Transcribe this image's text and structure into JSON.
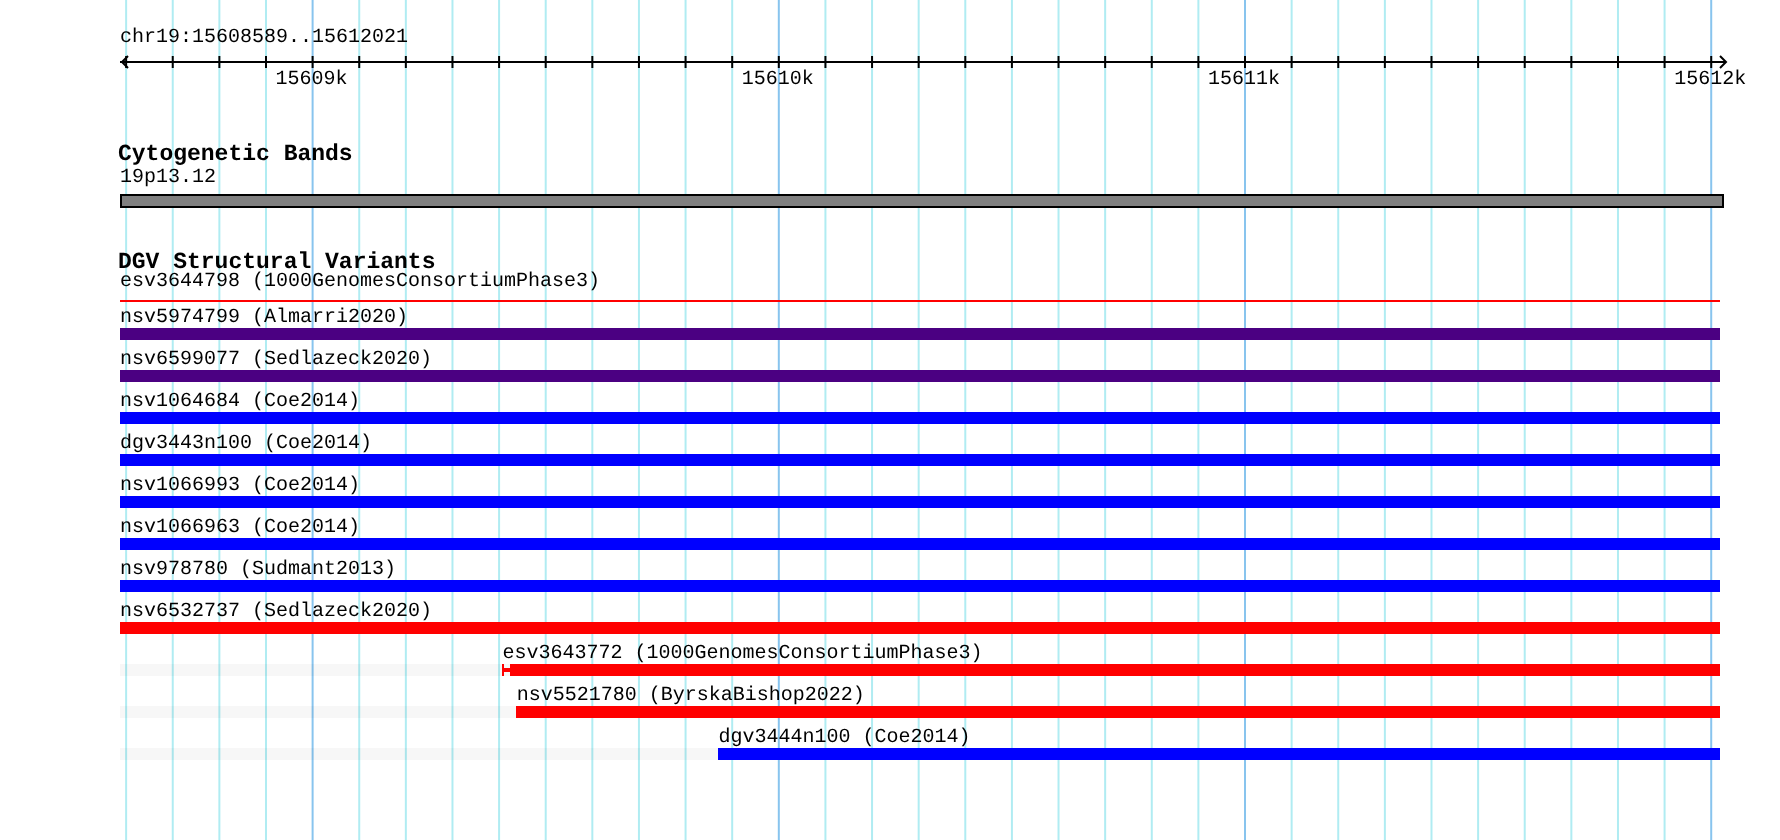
{
  "ruler": {
    "location": "chr19:15608589..15612021",
    "labels": [
      "15609k",
      "15610k",
      "15611k",
      "15612k"
    ]
  },
  "tracks": [
    {
      "title": "Cytogenetic Bands",
      "kind": "bands",
      "bands": [
        {
          "name": "19p13.12"
        }
      ]
    },
    {
      "title": "DGV Structural Variants",
      "kind": "features",
      "features": [
        {
          "name": "esv3644798 (1000GenomesConsortiumPhase3)",
          "kind": "line",
          "color": "#ff0000"
        },
        {
          "name": "nsv5974799 (Almarri2020)",
          "kind": "bar",
          "color": "#4b0082"
        },
        {
          "name": "nsv6599077 (Sedlazeck2020)",
          "kind": "bar",
          "color": "#4b0082"
        },
        {
          "name": "nsv1064684 (Coe2014)",
          "kind": "bar",
          "color": "#0000ff"
        },
        {
          "name": "dgv3443n100 (Coe2014)",
          "kind": "bar",
          "color": "#0000ff"
        },
        {
          "name": "nsv1066993 (Coe2014)",
          "kind": "bar",
          "color": "#0000ff"
        },
        {
          "name": "nsv1066963 (Coe2014)",
          "kind": "bar",
          "color": "#0000ff"
        },
        {
          "name": "nsv978780 (Sudmant2013)",
          "kind": "bar",
          "color": "#0000ff"
        },
        {
          "name": "nsv6532737 (Sedlazeck2020)",
          "kind": "bar",
          "color": "#ff0000"
        },
        {
          "name": "esv3643772 (1000GenomesConsortiumPhase3)",
          "kind": "capped",
          "color": "#ff0000",
          "level": 0.761
        },
        {
          "name": "nsv5521780 (ByrskaBishop2022)",
          "kind": "bar",
          "color": "#ff0000",
          "level": 0.752
        },
        {
          "name": "dgv3444n100 (Coe2014)",
          "kind": "bar",
          "color": "#0000ff",
          "level": 0.626
        }
      ]
    }
  ]
}
